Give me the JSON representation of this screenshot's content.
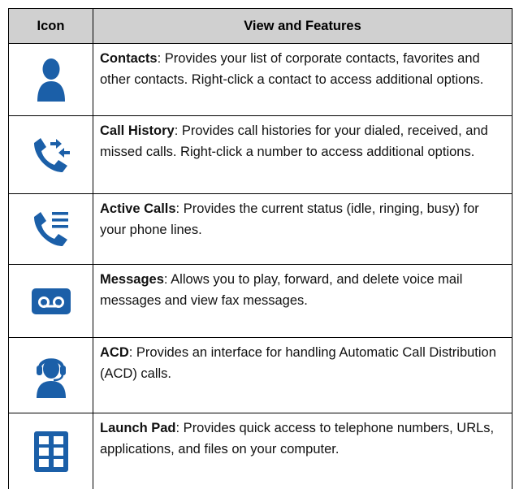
{
  "table": {
    "headers": {
      "icon": "Icon",
      "features": "View and Features"
    },
    "rows": [
      {
        "icon": "contacts-person-icon",
        "term": "Contacts",
        "description": ": Provides your list of corporate contacts, favorites and other contacts. Right-click a contact to access additional options."
      },
      {
        "icon": "call-history-phone-arrows-icon",
        "term": "Call History",
        "description": ": Provides call histories for your dialed, received, and missed calls. Right-click a number to access additional options."
      },
      {
        "icon": "active-calls-phone-lines-icon",
        "term": "Active Calls",
        "description": ": Provides the current status (idle, ringing, busy) for your phone lines."
      },
      {
        "icon": "voicemail-icon",
        "term": "Messages",
        "description": ": Allows you to play, forward, and delete voice mail messages and view fax messages."
      },
      {
        "icon": "acd-headset-agent-icon",
        "term": "ACD",
        "description": ": Provides an interface for handling Automatic Call Distribution (ACD) calls."
      },
      {
        "icon": "launch-pad-grid-icon",
        "term": "Launch Pad",
        "description": ": Provides quick access to telephone numbers, URLs, applications, and files on your computer."
      }
    ]
  },
  "colors": {
    "icon_blue": "#1b5fa8",
    "header_bg": "#d0d0d0"
  }
}
